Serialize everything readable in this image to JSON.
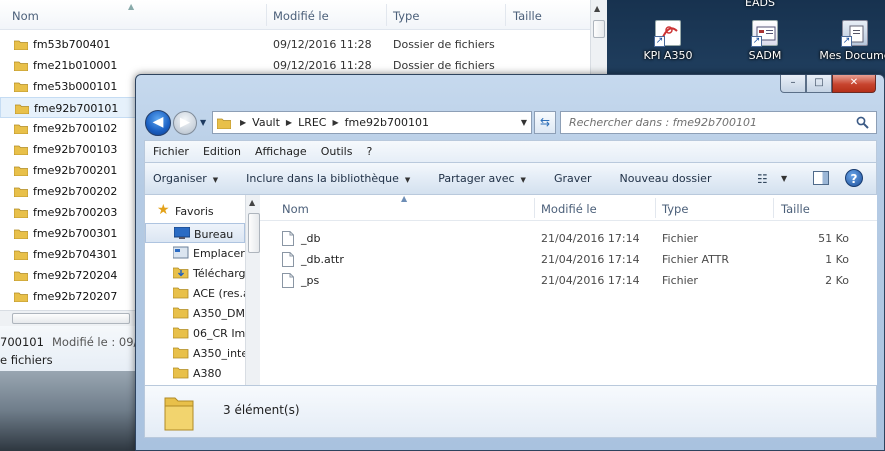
{
  "desktop": {
    "top_label": "EADS",
    "icons": [
      {
        "name": "KPI A350",
        "icon": "kpi-shortcut-icon"
      },
      {
        "name": "SADM",
        "icon": "sadm-shortcut-icon"
      },
      {
        "name": "Mes Docume",
        "icon": "documents-shortcut-icon"
      }
    ]
  },
  "bg_window": {
    "columns": {
      "name": "Nom",
      "modified": "Modifié le",
      "type": "Type",
      "size": "Taille"
    },
    "rows": [
      {
        "name": "fm53b700401",
        "date": "09/12/2016 11:28",
        "type": "Dossier de fichiers"
      },
      {
        "name": "fme21b010001",
        "date": "09/12/2016 11:28",
        "type": "Dossier de fichiers"
      },
      {
        "name": "fme53b000101",
        "date": "",
        "type": ""
      },
      {
        "name": "fme92b700101",
        "date": "",
        "type": ""
      },
      {
        "name": "fme92b700102",
        "date": "",
        "type": ""
      },
      {
        "name": "fme92b700103",
        "date": "",
        "type": ""
      },
      {
        "name": "fme92b700201",
        "date": "",
        "type": ""
      },
      {
        "name": "fme92b700202",
        "date": "",
        "type": ""
      },
      {
        "name": "fme92b700203",
        "date": "",
        "type": ""
      },
      {
        "name": "fme92b700301",
        "date": "",
        "type": ""
      },
      {
        "name": "fme92b704301",
        "date": "",
        "type": ""
      },
      {
        "name": "fme92b720204",
        "date": "",
        "type": ""
      },
      {
        "name": "fme92b720207",
        "date": "",
        "type": ""
      }
    ],
    "status": {
      "line1_name": "700101",
      "line1_meta": "Modifié le : 09/",
      "line2": "e fichiers"
    }
  },
  "fg_window": {
    "caption": {
      "min": "–",
      "max": "□",
      "close": "✕"
    },
    "nav": {
      "back": "◀",
      "forward": "▶"
    },
    "address": {
      "crumbs": [
        "Vault",
        "LREC",
        "fme92b700101"
      ]
    },
    "search": {
      "placeholder": "Rechercher dans : fme92b700101"
    },
    "menu": [
      "Fichier",
      "Edition",
      "Affichage",
      "Outils",
      "?"
    ],
    "commands": {
      "organize": "Organiser",
      "include": "Inclure dans la bibliothèque",
      "share": "Partager avec",
      "burn": "Graver",
      "new_folder": "Nouveau dossier"
    },
    "nav_pane": [
      {
        "label": "Favoris",
        "icon": "star-icon"
      },
      {
        "label": "Bureau",
        "icon": "desktop-icon"
      },
      {
        "label": "Emplacer",
        "icon": "places-icon"
      },
      {
        "label": "Télécharg",
        "icon": "download-folder-icon"
      },
      {
        "label": "ACE (res.a",
        "icon": "folder-icon"
      },
      {
        "label": "A350_DM",
        "icon": "folder-icon"
      },
      {
        "label": "06_CR Im",
        "icon": "folder-icon"
      },
      {
        "label": "A350_inte",
        "icon": "folder-icon"
      },
      {
        "label": "A380",
        "icon": "folder-icon"
      }
    ],
    "columns": {
      "name": "Nom",
      "modified": "Modifié le",
      "type": "Type",
      "size": "Taille"
    },
    "files": [
      {
        "name": "_db",
        "date": "21/04/2016 17:14",
        "type": "Fichier",
        "size": "51 Ko"
      },
      {
        "name": "_db.attr",
        "date": "21/04/2016 17:14",
        "type": "Fichier ATTR",
        "size": "1 Ko"
      },
      {
        "name": "_ps",
        "date": "21/04/2016 17:14",
        "type": "Fichier",
        "size": "2 Ko"
      }
    ],
    "details": {
      "count": "3 élément(s)"
    }
  },
  "colors": {
    "folder": "#e8c04a",
    "accent": "#1d5fbf",
    "selection": "#dbe6f3"
  }
}
